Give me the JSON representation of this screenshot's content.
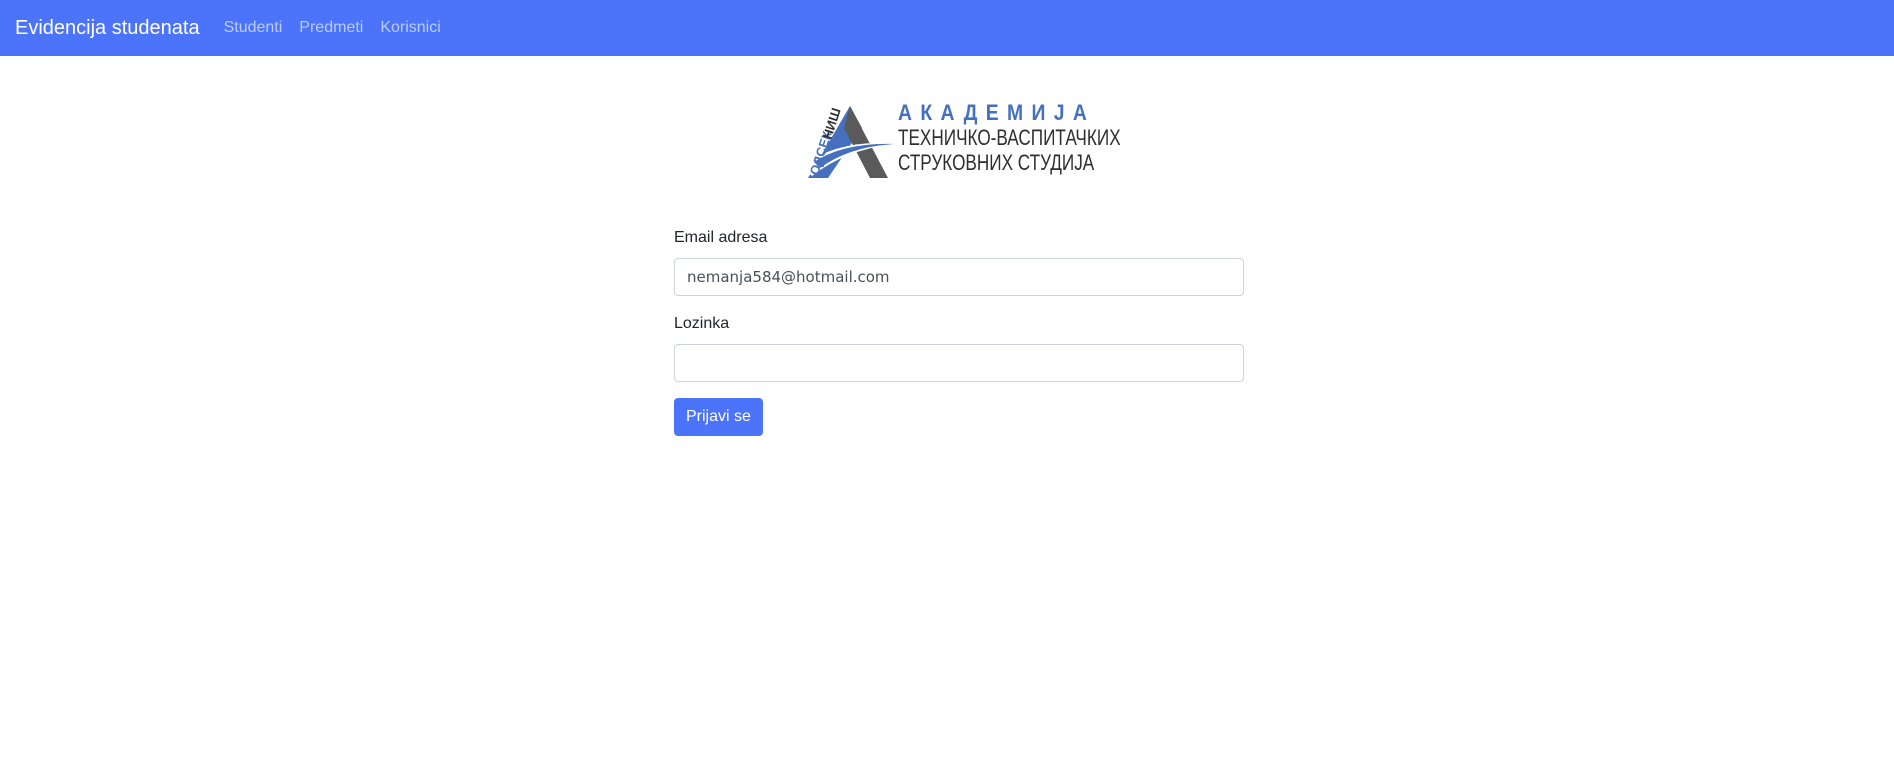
{
  "navbar": {
    "brand": "Evidencija studenata",
    "links": [
      {
        "label": "Studenti"
      },
      {
        "label": "Predmeti"
      },
      {
        "label": "Korisnici"
      }
    ],
    "background_color": "#4b74fb"
  },
  "logo": {
    "vertical_text": "ОДСЕК НИШ",
    "line1": "АКАДЕМИЈА",
    "line2": "ТЕХНИЧКО-ВАСПИТАЧКИХ",
    "line3": "СТРУКОВНИХ СТУДИЈА",
    "accent_color": "#4570bd",
    "dark_color": "#5a5a5a"
  },
  "form": {
    "email_label": "Email adresa",
    "email_value": "nemanja584@hotmail.com",
    "password_label": "Lozinka",
    "password_value": "",
    "submit_label": "Prijavi se"
  }
}
